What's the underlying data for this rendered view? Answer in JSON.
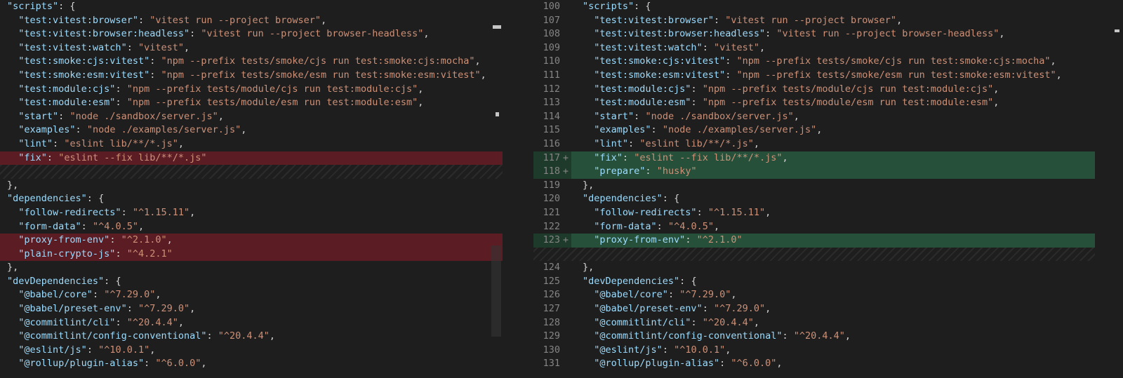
{
  "left": {
    "rows": [
      {
        "type": "normal",
        "text": "\"scripts\": {"
      },
      {
        "type": "normal",
        "text": "  \"test:vitest:browser\": \"vitest run --project browser\","
      },
      {
        "type": "normal",
        "text": "  \"test:vitest:browser:headless\": \"vitest run --project browser-headless\","
      },
      {
        "type": "normal",
        "text": "  \"test:vitest:watch\": \"vitest\","
      },
      {
        "type": "normal",
        "text": "  \"test:smoke:cjs:vitest\": \"npm --prefix tests/smoke/cjs run test:smoke:cjs:mocha\","
      },
      {
        "type": "normal",
        "text": "  \"test:smoke:esm:vitest\": \"npm --prefix tests/smoke/esm run test:smoke:esm:vitest\","
      },
      {
        "type": "normal",
        "text": "  \"test:module:cjs\": \"npm --prefix tests/module/cjs run test:module:cjs\","
      },
      {
        "type": "normal",
        "text": "  \"test:module:esm\": \"npm --prefix tests/module/esm run test:module:esm\","
      },
      {
        "type": "normal",
        "text": "  \"start\": \"node ./sandbox/server.js\","
      },
      {
        "type": "normal",
        "text": "  \"examples\": \"node ./examples/server.js\","
      },
      {
        "type": "normal",
        "text": "  \"lint\": \"eslint lib/**/*.js\","
      },
      {
        "type": "removed",
        "text": "  \"fix\": \"eslint --fix lib/**/*.js\""
      },
      {
        "type": "filler",
        "text": ""
      },
      {
        "type": "normal",
        "text": "},"
      },
      {
        "type": "normal",
        "text": "\"dependencies\": {"
      },
      {
        "type": "normal",
        "text": "  \"follow-redirects\": \"^1.15.11\","
      },
      {
        "type": "normal",
        "text": "  \"form-data\": \"^4.0.5\","
      },
      {
        "type": "removed",
        "text": "  \"proxy-from-env\": \"^2.1.0\","
      },
      {
        "type": "removed",
        "text": "  \"plain-crypto-js\": \"^4.2.1\""
      },
      {
        "type": "normal",
        "text": "},"
      },
      {
        "type": "normal",
        "text": "\"devDependencies\": {"
      },
      {
        "type": "normal",
        "text": "  \"@babel/core\": \"^7.29.0\","
      },
      {
        "type": "normal",
        "text": "  \"@babel/preset-env\": \"^7.29.0\","
      },
      {
        "type": "normal",
        "text": "  \"@commitlint/cli\": \"^20.4.4\","
      },
      {
        "type": "normal",
        "text": "  \"@commitlint/config-conventional\": \"^20.4.4\","
      },
      {
        "type": "normal",
        "text": "  \"@eslint/js\": \"^10.0.1\","
      },
      {
        "type": "normal",
        "text": "  \"@rollup/plugin-alias\": \"^6.0.0\","
      }
    ]
  },
  "right": {
    "rows": [
      {
        "type": "normal",
        "ln": "100",
        "marker": "",
        "text": "\"scripts\": {"
      },
      {
        "type": "normal",
        "ln": "107",
        "marker": "",
        "text": "  \"test:vitest:browser\": \"vitest run --project browser\","
      },
      {
        "type": "normal",
        "ln": "108",
        "marker": "",
        "text": "  \"test:vitest:browser:headless\": \"vitest run --project browser-headless\","
      },
      {
        "type": "normal",
        "ln": "109",
        "marker": "",
        "text": "  \"test:vitest:watch\": \"vitest\","
      },
      {
        "type": "normal",
        "ln": "110",
        "marker": "",
        "text": "  \"test:smoke:cjs:vitest\": \"npm --prefix tests/smoke/cjs run test:smoke:cjs:mocha\","
      },
      {
        "type": "normal",
        "ln": "111",
        "marker": "",
        "text": "  \"test:smoke:esm:vitest\": \"npm --prefix tests/smoke/esm run test:smoke:esm:vitest\","
      },
      {
        "type": "normal",
        "ln": "112",
        "marker": "",
        "text": "  \"test:module:cjs\": \"npm --prefix tests/module/cjs run test:module:cjs\","
      },
      {
        "type": "normal",
        "ln": "113",
        "marker": "",
        "text": "  \"test:module:esm\": \"npm --prefix tests/module/esm run test:module:esm\","
      },
      {
        "type": "normal",
        "ln": "114",
        "marker": "",
        "text": "  \"start\": \"node ./sandbox/server.js\","
      },
      {
        "type": "normal",
        "ln": "115",
        "marker": "",
        "text": "  \"examples\": \"node ./examples/server.js\","
      },
      {
        "type": "normal",
        "ln": "116",
        "marker": "",
        "text": "  \"lint\": \"eslint lib/**/*.js\","
      },
      {
        "type": "added",
        "ln": "117",
        "marker": "+",
        "text": "  \"fix\": \"eslint --fix lib/**/*.js\","
      },
      {
        "type": "added",
        "ln": "118",
        "marker": "+",
        "text": "  \"prepare\": \"husky\""
      },
      {
        "type": "normal",
        "ln": "119",
        "marker": "",
        "text": "},"
      },
      {
        "type": "normal",
        "ln": "120",
        "marker": "",
        "text": "\"dependencies\": {"
      },
      {
        "type": "normal",
        "ln": "121",
        "marker": "",
        "text": "  \"follow-redirects\": \"^1.15.11\","
      },
      {
        "type": "normal",
        "ln": "122",
        "marker": "",
        "text": "  \"form-data\": \"^4.0.5\","
      },
      {
        "type": "added",
        "ln": "123",
        "marker": "+",
        "text": "  \"proxy-from-env\": \"^2.1.0\""
      },
      {
        "type": "filler",
        "ln": "",
        "marker": "",
        "text": ""
      },
      {
        "type": "normal",
        "ln": "124",
        "marker": "",
        "text": "},"
      },
      {
        "type": "normal",
        "ln": "125",
        "marker": "",
        "text": "\"devDependencies\": {"
      },
      {
        "type": "normal",
        "ln": "126",
        "marker": "",
        "text": "  \"@babel/core\": \"^7.29.0\","
      },
      {
        "type": "normal",
        "ln": "127",
        "marker": "",
        "text": "  \"@babel/preset-env\": \"^7.29.0\","
      },
      {
        "type": "normal",
        "ln": "128",
        "marker": "",
        "text": "  \"@commitlint/cli\": \"^20.4.4\","
      },
      {
        "type": "normal",
        "ln": "129",
        "marker": "",
        "text": "  \"@commitlint/config-conventional\": \"^20.4.4\","
      },
      {
        "type": "normal",
        "ln": "130",
        "marker": "",
        "text": "  \"@eslint/js\": \"^10.0.1\","
      },
      {
        "type": "normal",
        "ln": "131",
        "marker": "",
        "text": "  \"@rollup/plugin-alias\": \"^6.0.0\","
      }
    ]
  },
  "colors": {
    "removed_line": "#4b1818",
    "added_line": "#1e3a2a",
    "key": "#9cdcfe",
    "string": "#ce9178"
  }
}
